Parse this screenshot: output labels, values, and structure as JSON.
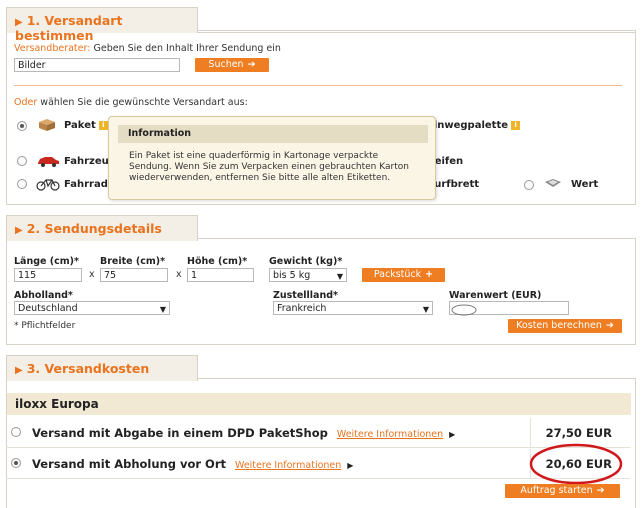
{
  "section1": {
    "title": "1. Versandart bestimmen",
    "advisor_label": "Versandberater:",
    "advisor_text": "Geben Sie den Inhalt Ihrer Sendung ein",
    "search_value": "Bilder",
    "search_button": "Suchen",
    "or_label": "Oder",
    "or_text": "wählen Sie die gewünschte Versandart aus:",
    "options": {
      "paket": "Paket",
      "einwegpalette": "Einwegpalette",
      "fahrzeug": "Fahrzeug",
      "reifen": "Reifen",
      "fahrrad": "Fahrrad",
      "surfbrett": "Surfbrett",
      "wert": "Wert"
    },
    "info_badge": "i"
  },
  "popup": {
    "title": "Information",
    "body": "Ein Paket ist eine quaderförmig in Kartonage verpackte Sendung. Wenn Sie zum Verpacken einen gebrauchten Karton wiederverwenden, entfernen Sie bitte alle alten Etiketten."
  },
  "section2": {
    "title": "2. Sendungsdetails",
    "length_label": "Länge (cm)*",
    "length_value": "115",
    "width_label": "Breite (cm)*",
    "width_value": "75",
    "height_label": "Höhe (cm)*",
    "height_value": "1",
    "weight_label": "Gewicht (kg)*",
    "weight_value": "bis 5 kg",
    "add_button": "Packstück",
    "times": "x",
    "origin_label": "Abholland*",
    "origin_value": "Deutschland",
    "dest_label": "Zustellland*",
    "dest_value": "Frankreich",
    "value_label": "Warenwert (EUR)",
    "value_value": "",
    "calc_button": "Kosten berechnen",
    "required_note": "* Pflichtfelder"
  },
  "section3": {
    "title": "3. Versandkosten",
    "provider": "iloxx Europa",
    "rows": [
      {
        "label": "Versand mit Abgabe in einem DPD PaketShop",
        "link": "Weitere Informationen",
        "price": "27,50 EUR",
        "selected": false
      },
      {
        "label": "Versand mit Abholung vor Ort",
        "link": "Weitere Informationen",
        "price": "20,60 EUR",
        "selected": true
      }
    ],
    "start_button": "Auftrag starten"
  },
  "colors": {
    "accent": "#e9731e",
    "button": "#ef7d22",
    "tab_bg": "#f3efe6",
    "highlight_circle": "#d0181a"
  }
}
